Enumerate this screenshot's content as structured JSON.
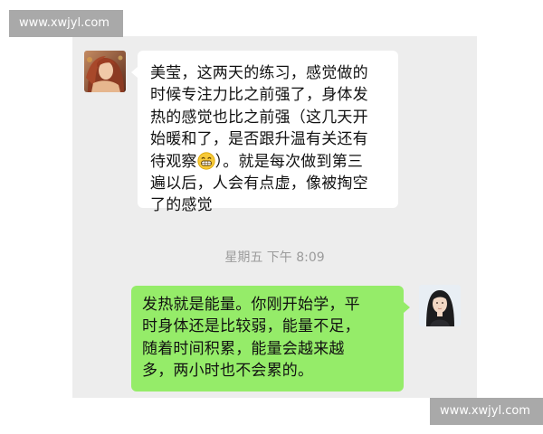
{
  "watermarks": {
    "top": "www.xwjyl.com",
    "bottom": "www.xwjyl.com"
  },
  "incoming": {
    "lines": [
      "美莹，这两天的练习，感觉做的",
      "时候专注力比之前强了，身体发",
      "热的感觉也比之前强（这几天开",
      "始暖和了，是否跟升温有关还有",
      "待观察",
      "）。就是每次做到第三",
      "遍以后，人会有点虚，像被掏空",
      "了的感觉"
    ],
    "emoji": "grinning-emoji"
  },
  "timestamp": "星期五 下午 8:09",
  "outgoing": {
    "lines": [
      "发热就是能量。你刚开始学，平",
      "时身体还是比较弱，能量不足，",
      "随着时间积累，能量会越来越",
      "多，两小时也不会累的。"
    ]
  },
  "colors": {
    "chat_background": "#ededed",
    "incoming_bubble": "#ffffff",
    "outgoing_bubble": "#95ec69",
    "timestamp_text": "#9b9b9b",
    "watermark_background": "#a9a9a9"
  }
}
